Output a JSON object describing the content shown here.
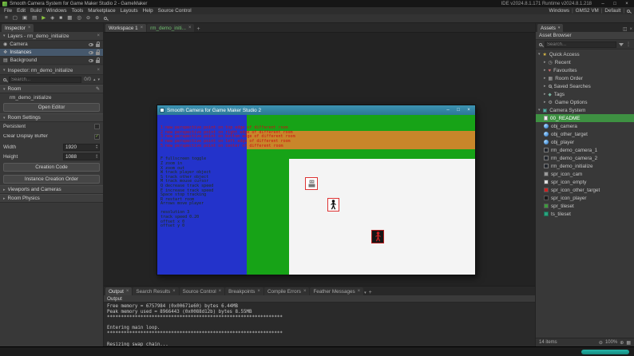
{
  "titlebar": {
    "title": "Smooth Camera System for Game Maker Studio 2 - GameMaker",
    "version_info": "IDE v2024.8.1.171  Runtime v2024.8.1.218"
  },
  "menubar": {
    "items": [
      "File",
      "Edit",
      "Build",
      "Windows",
      "Tools",
      "Marketplace",
      "Layouts",
      "Help",
      "Source Control"
    ],
    "target_label": "Windows",
    "runtime_label": "GMS2 VM",
    "layout_label": "Default"
  },
  "inspector": {
    "tab_label": "Inspector",
    "layers_header": "Layers - rm_demo_initialize",
    "layers": [
      {
        "name": "Camera"
      },
      {
        "name": "Instances"
      },
      {
        "name": "Background"
      }
    ],
    "inspector_header": "Inspector: rm_demo_initialize",
    "search_placeholder": "Search...",
    "search_count": "0/0",
    "room_section": "Room",
    "room_name": "rm_demo_initialize",
    "open_editor": "Open Editor",
    "room_settings": "Room Settings",
    "persistent": "Persistent",
    "clear_display_buffer": "Clear Display Buffer",
    "width_label": "Width",
    "width_value": "1920",
    "height_label": "Height",
    "height_value": "1088",
    "creation_code": "Creation Code",
    "instance_creation_order": "Instance Creation Order",
    "viewports": "Viewports and Cameras",
    "room_physics": "Room Physics"
  },
  "workspace": {
    "tab1": "Workspace 1",
    "tab2": "rm_demo_initi..."
  },
  "game": {
    "window_title": "Smooth Camera for Game Maker Studio 2",
    "red_text": "1 new perspective point on top edge of different room\n2 new perspective point on right edge of different room\n3 new perspective point on bottom edge of different room\n4 new perspective point on left edge of different room\n5 new perspective point on center of different room",
    "dark_text": "F fullscreen toggle\nZ zoom in\nX zoom out\nW track player object\nS track other object\nM track mouse cursor\nQ decrease track speed\nE increase track speed\nSpace stop tracking\nR restart room\nArrows move player\n\nresolution 3\ntrack speed 0.20\noffset x 0\noffset y 0"
  },
  "output": {
    "tabs": [
      "Output",
      "Search Results",
      "Source Control",
      "Breakpoints",
      "Compile Errors",
      "Feather Messages"
    ],
    "header": "Output",
    "console_text": "Free memory = 6757984 (0x00671e60) bytes 6.44MB\nPeak memory used = 8966443 (0x0088d12b) bytes 8.55MB\n***************************************************************\n\nEntering main loop.\n***************************************************************\n\nResizing swap chain..."
  },
  "assets": {
    "tab_label": "Assets",
    "browser_header": "Asset Browser",
    "search_placeholder": "Search...",
    "quick_access_label": "Quick Access",
    "quick_access": [
      {
        "label": "Recent"
      },
      {
        "label": "Favourites"
      },
      {
        "label": "Room Order"
      },
      {
        "label": "Saved Searches"
      },
      {
        "label": "Tags"
      },
      {
        "label": "Game Options"
      }
    ],
    "group_label": "Camera System",
    "items": [
      {
        "label": "00_README"
      },
      {
        "label": "obj_camera"
      },
      {
        "label": "obj_other_target"
      },
      {
        "label": "obj_player"
      },
      {
        "label": "rm_demo_camera_1"
      },
      {
        "label": "rm_demo_camera_2"
      },
      {
        "label": "rm_demo_initialize"
      },
      {
        "label": "spr_icon_cam"
      },
      {
        "label": "spr_icon_empty"
      },
      {
        "label": "spr_icon_other_target"
      },
      {
        "label": "spr_icon_player"
      },
      {
        "label": "spr_tileset"
      },
      {
        "label": "ts_tileset"
      }
    ],
    "item_count": "14 items",
    "zoom_level": "100%"
  },
  "colors": {
    "selection_green": "#3e9142",
    "game_blue": "#2333cb",
    "game_green": "#17a317",
    "game_orange": "#c8862a",
    "progress_teal": "#27b5a8"
  }
}
